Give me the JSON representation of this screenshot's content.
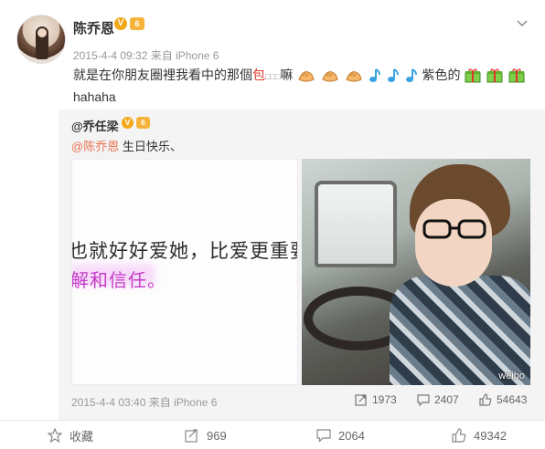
{
  "post": {
    "username": "陈乔恩",
    "badge_v": "V",
    "badge_level": "6",
    "meta": "2015-4-4 09:32 来自 iPhone 6",
    "text_before": "就是在你朋友圈裡我看中的那個",
    "text_red": "包",
    "text_mid": "嘛",
    "text_purple": "紫色的",
    "text_line2": "hahaha"
  },
  "repost": {
    "username": "@乔任梁",
    "badge_v": "V",
    "badge_level": "6",
    "mention": "@陈乔恩",
    "text": " 生日快乐、",
    "image_left_line1": "也就好好爱她，比爱更重要的是",
    "image_left_line2": "解和信任。",
    "image_right_watermark": "weibo",
    "meta": "2015-4-4 03:40 来自 iPhone 6",
    "stats": {
      "reposts": "1973",
      "comments": "2407",
      "likes": "54643"
    }
  },
  "actions": {
    "favorite": "收藏",
    "repost": "969",
    "comment": "2064",
    "like": "49342"
  },
  "icons": {
    "more": "chevron-down-icon",
    "repost": "repost-icon",
    "comment": "comment-icon",
    "like": "thumbs-up-icon",
    "favorite": "star-icon"
  },
  "colors": {
    "mention": "#eb7350",
    "red_text": "#e0362c",
    "badge": "#f3a818"
  }
}
